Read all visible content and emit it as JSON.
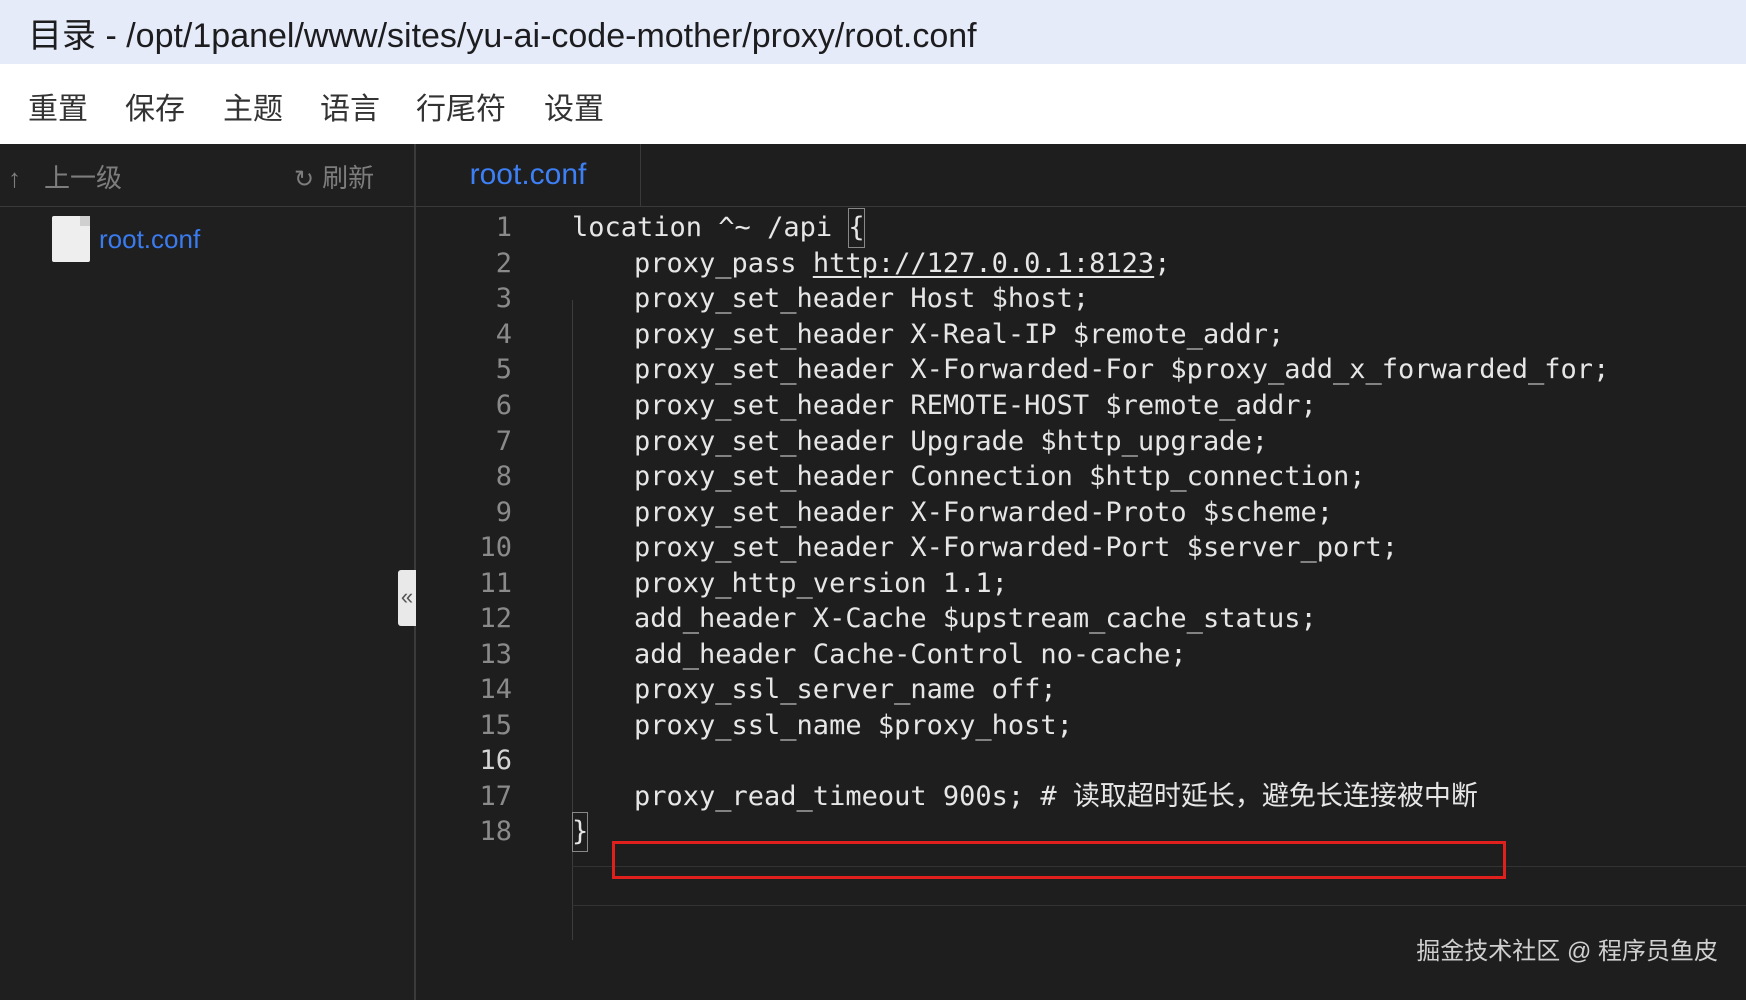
{
  "window": {
    "title": "目录 - /opt/1panel/www/sites/yu-ai-code-mother/proxy/root.conf"
  },
  "toolbar": {
    "items": [
      {
        "label": "重置"
      },
      {
        "label": "保存"
      },
      {
        "label": "主题"
      },
      {
        "label": "语言"
      },
      {
        "label": "行尾符"
      },
      {
        "label": "设置"
      }
    ]
  },
  "sidebar": {
    "up_arrow": "↑",
    "up_label": "上一级",
    "refresh_glyph": "↻",
    "refresh_label": "刷新",
    "files": [
      {
        "name": "root.conf",
        "icon": "file-icon"
      }
    ],
    "collapse_glyph": "«"
  },
  "editor": {
    "tab": {
      "label": "root.conf"
    },
    "active_line": 16,
    "highlight_line": 17,
    "highlight_color": "#e0201c",
    "lines": [
      {
        "n": "1",
        "text": "location ^~ /api ",
        "bracket": "{"
      },
      {
        "n": "2",
        "pre": "proxy_pass ",
        "link": "http://127.0.0.1:8123",
        "post": ";"
      },
      {
        "n": "3",
        "text": "proxy_set_header Host $host;"
      },
      {
        "n": "4",
        "text": "proxy_set_header X-Real-IP $remote_addr;"
      },
      {
        "n": "5",
        "text": "proxy_set_header X-Forwarded-For $proxy_add_x_forwarded_for;"
      },
      {
        "n": "6",
        "text": "proxy_set_header REMOTE-HOST $remote_addr;"
      },
      {
        "n": "7",
        "text": "proxy_set_header Upgrade $http_upgrade;"
      },
      {
        "n": "8",
        "text": "proxy_set_header Connection $http_connection;"
      },
      {
        "n": "9",
        "text": "proxy_set_header X-Forwarded-Proto $scheme;"
      },
      {
        "n": "10",
        "text": "proxy_set_header X-Forwarded-Port $server_port;"
      },
      {
        "n": "11",
        "text": "proxy_http_version 1.1;"
      },
      {
        "n": "12",
        "text": "add_header X-Cache $upstream_cache_status;"
      },
      {
        "n": "13",
        "text": "add_header Cache-Control no-cache;"
      },
      {
        "n": "14",
        "text": "proxy_ssl_server_name off;"
      },
      {
        "n": "15",
        "text": "proxy_ssl_name $proxy_host;"
      },
      {
        "n": "16",
        "text": ""
      },
      {
        "n": "17",
        "text": "proxy_read_timeout 900s; # 读取超时延长，避免长连接被中断"
      },
      {
        "n": "18",
        "bracket": "}"
      }
    ]
  },
  "watermark": "掘金技术社区 @ 程序员鱼皮"
}
